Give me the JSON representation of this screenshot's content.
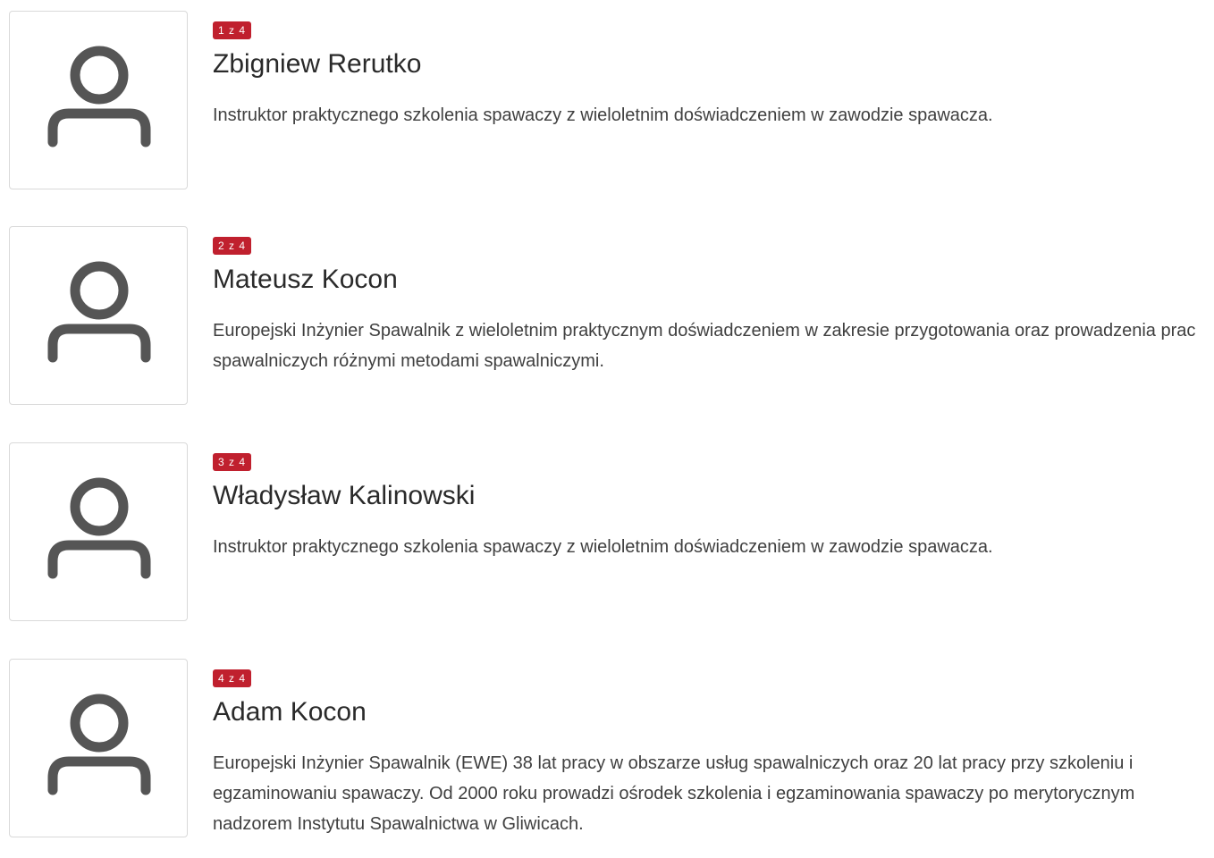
{
  "team": [
    {
      "counter": "1 z 4",
      "name": "Zbigniew Rerutko",
      "description": "Instruktor praktycznego szkolenia spawaczy z wieloletnim doświadczeniem w zawodzie spawacza.",
      "avatar_icon": "user-placeholder-icon"
    },
    {
      "counter": "2 z 4",
      "name": "Mateusz Kocon",
      "description": "Europejski Inżynier Spawalnik z wieloletnim praktycznym doświadczeniem w zakresie przygotowania oraz prowadzenia prac spawalniczych różnymi metodami spawalniczymi.",
      "avatar_icon": "user-placeholder-icon"
    },
    {
      "counter": "3 z 4",
      "name": "Władysław Kalinowski",
      "description": "Instruktor praktycznego szkolenia spawaczy z wieloletnim doświadczeniem w zawodzie spawacza.",
      "avatar_icon": "user-placeholder-icon"
    },
    {
      "counter": "4 z 4",
      "name": "Adam Kocon",
      "description": "Europejski Inżynier Spawalnik (EWE) 38 lat pracy w obszarze usług spawalniczych oraz 20 lat pracy przy szkoleniu i egzaminowaniu spawaczy. Od 2000 roku prowadzi ośrodek szkolenia i egzaminowania spawaczy po merytorycznym nadzorem Instytutu Spawalnictwa w Gliwicach.",
      "avatar_icon": "user-placeholder-icon"
    }
  ],
  "colors": {
    "badge_bg": "#c0202e",
    "icon": "#555555",
    "border": "#d9d9d9"
  }
}
